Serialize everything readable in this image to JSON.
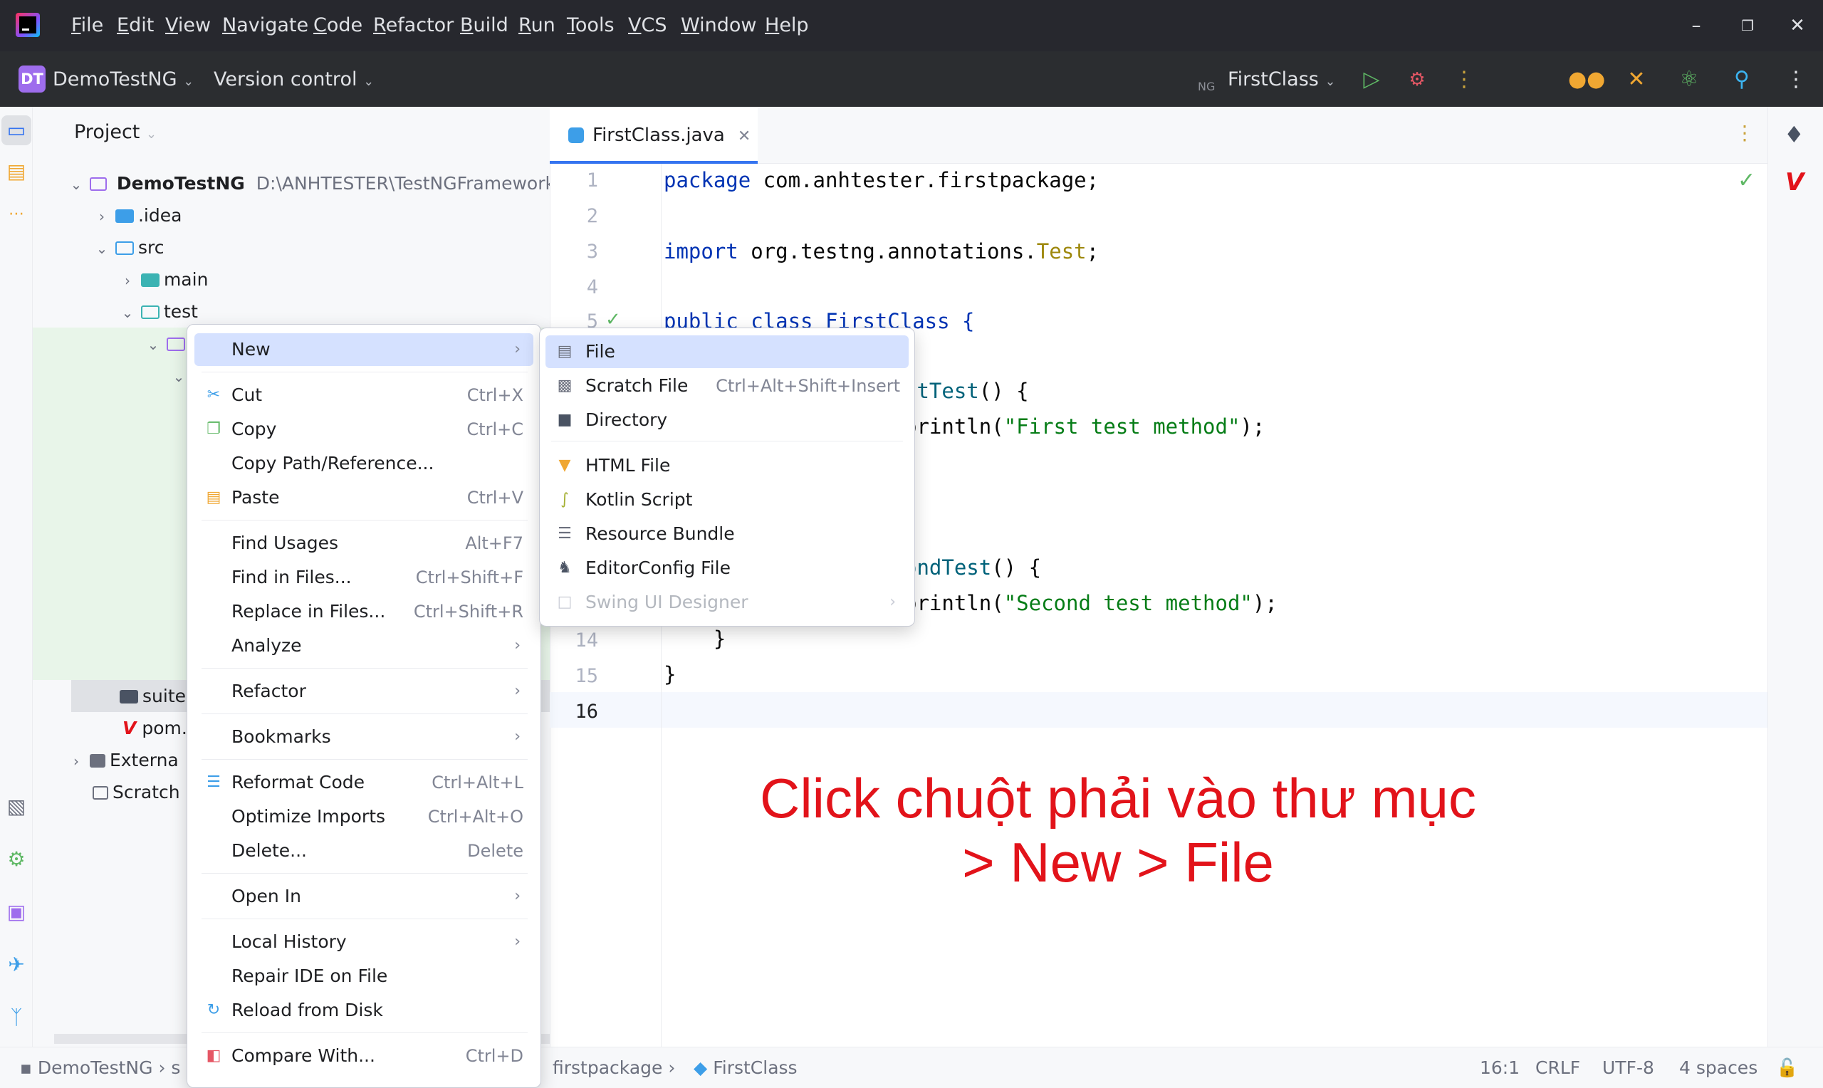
{
  "menubar": {
    "items": [
      "File",
      "Edit",
      "View",
      "Navigate",
      "Code",
      "Refactor",
      "Build",
      "Run",
      "Tools",
      "VCS",
      "Window",
      "Help"
    ]
  },
  "toolbar": {
    "project_badge": "DT",
    "project_name": "DemoTestNG",
    "version_control": "Version control",
    "run_config": "FirstClass",
    "run_config_badge": "NG"
  },
  "project_panel": {
    "title": "Project",
    "tree": [
      {
        "label": "DemoTestNG",
        "path": "D:\\ANHTESTER\\TestNGFramework"
      },
      {
        "label": ".idea"
      },
      {
        "label": "src"
      },
      {
        "label": "main"
      },
      {
        "label": "test"
      },
      {
        "label": "suite"
      },
      {
        "label": "pom."
      },
      {
        "label": "Externa"
      },
      {
        "label": "Scratch"
      }
    ]
  },
  "editor": {
    "tab_label": "FirstClass.java",
    "line_numbers": [
      "1",
      "2",
      "3",
      "4",
      "5",
      "14",
      "15",
      "16"
    ],
    "code": {
      "l1_kw": "package",
      "l1_rest": " com.anhtester.firstpackage;",
      "l3_kw": "import",
      "l3_rest": " org.testng.annotations.",
      "l3_ann": "Test",
      "l3_end": ";",
      "l5": "public class FirstClass {",
      "l7_fn": "stTest",
      "l7_rest": "() {",
      "l8_rest": "println(",
      "l8_str": "\"First test method\"",
      "l8_end": ");",
      "l12_fn": "ondTest",
      "l12_rest": "() {",
      "l13_rest": "println(",
      "l13_str": "\"Second test method\"",
      "l13_end": ");",
      "l14": "    }",
      "l15": "}"
    }
  },
  "context_menu": {
    "items": [
      {
        "label": "New",
        "submenu": true
      },
      {
        "label": "Cut",
        "shortcut": "Ctrl+X"
      },
      {
        "label": "Copy",
        "shortcut": "Ctrl+C"
      },
      {
        "label": "Copy Path/Reference..."
      },
      {
        "label": "Paste",
        "shortcut": "Ctrl+V"
      },
      {
        "label": "Find Usages",
        "shortcut": "Alt+F7"
      },
      {
        "label": "Find in Files...",
        "shortcut": "Ctrl+Shift+F"
      },
      {
        "label": "Replace in Files...",
        "shortcut": "Ctrl+Shift+R"
      },
      {
        "label": "Analyze",
        "submenu": true
      },
      {
        "label": "Refactor",
        "submenu": true
      },
      {
        "label": "Bookmarks",
        "submenu": true
      },
      {
        "label": "Reformat Code",
        "shortcut": "Ctrl+Alt+L"
      },
      {
        "label": "Optimize Imports",
        "shortcut": "Ctrl+Alt+O"
      },
      {
        "label": "Delete...",
        "shortcut": "Delete"
      },
      {
        "label": "Open In",
        "submenu": true
      },
      {
        "label": "Local History",
        "submenu": true
      },
      {
        "label": "Repair IDE on File"
      },
      {
        "label": "Reload from Disk"
      },
      {
        "label": "Compare With...",
        "shortcut": "Ctrl+D"
      }
    ]
  },
  "new_submenu": {
    "items": [
      {
        "label": "File"
      },
      {
        "label": "Scratch File",
        "shortcut": "Ctrl+Alt+Shift+Insert"
      },
      {
        "label": "Directory"
      },
      {
        "label": "HTML File"
      },
      {
        "label": "Kotlin Script"
      },
      {
        "label": "Resource Bundle"
      },
      {
        "label": "EditorConfig File"
      },
      {
        "label": "Swing UI Designer",
        "submenu": true,
        "disabled": true
      }
    ]
  },
  "annotation": {
    "line1": "Click chuột phải vào thư mục",
    "line2": "> New > File"
  },
  "statusbar": {
    "crumb1": "DemoTestNG",
    "crumb_partial": "s",
    "crumb2": "firstpackage",
    "crumb3": "FirstClass",
    "position": "16:1",
    "line_sep": "CRLF",
    "encoding": "UTF-8",
    "indent": "4 spaces"
  },
  "colors": {
    "accent": "#3574f0",
    "selection": "#d5e1ff",
    "annotation": "#e2131a",
    "titlebar": "#27282e",
    "toolbar": "#2b2d30"
  }
}
